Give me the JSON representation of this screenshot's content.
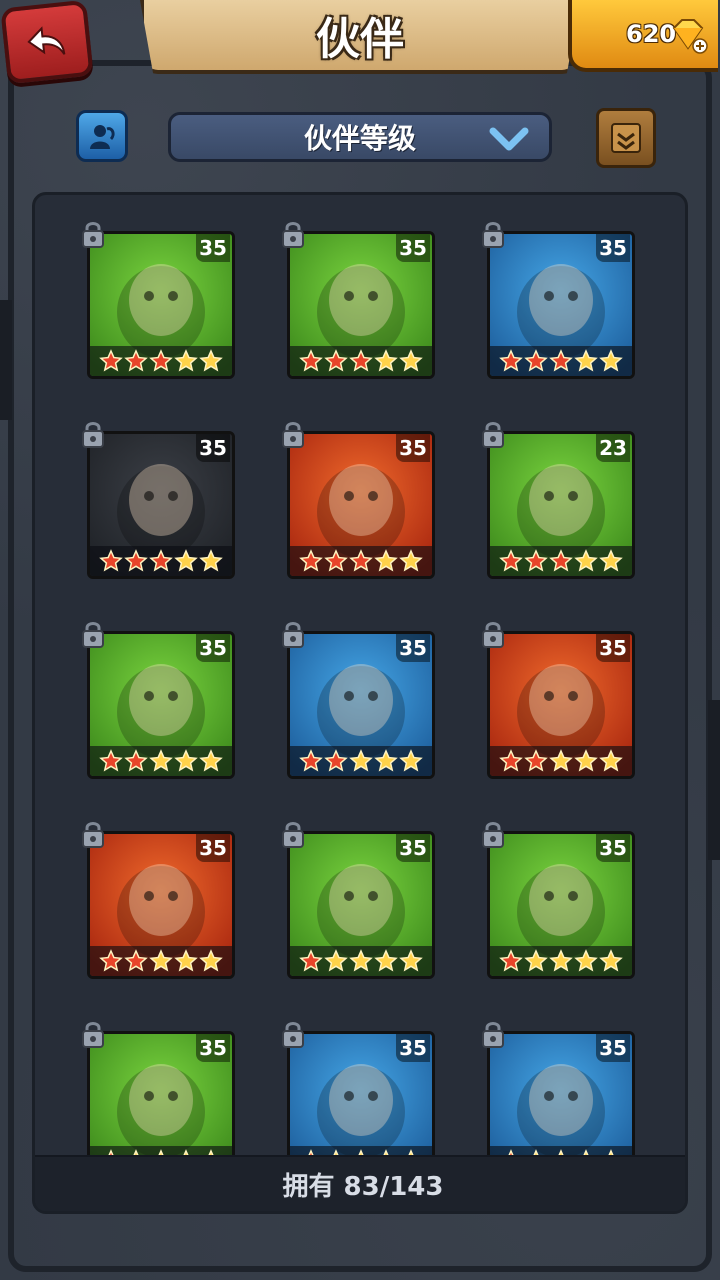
{
  "header": {
    "title": "伙伴",
    "gems": "620"
  },
  "toolbar": {
    "sort_label": "伙伴等级"
  },
  "colors": {
    "star_gold": "#ffd24a",
    "star_red": "#e8452a",
    "bg_green": "#4fb02c",
    "bg_blue": "#2f86c8",
    "bg_red": "#d9421c"
  },
  "companions": [
    {
      "level": "35",
      "stars": 5,
      "red_stars": 3,
      "bg": "green",
      "icon": "green-dino-icon"
    },
    {
      "level": "35",
      "stars": 5,
      "red_stars": 3,
      "bg": "green",
      "icon": "bandana-warrior-icon"
    },
    {
      "level": "35",
      "stars": 5,
      "red_stars": 3,
      "bg": "blue",
      "icon": "pirate-brute-icon"
    },
    {
      "level": "35",
      "stars": 5,
      "red_stars": 3,
      "bg": "dark",
      "icon": "horned-beast-icon"
    },
    {
      "level": "35",
      "stars": 5,
      "red_stars": 3,
      "bg": "red",
      "icon": "skull-huntress-icon"
    },
    {
      "level": "23",
      "stars": 5,
      "red_stars": 3,
      "bg": "green",
      "icon": "scarecrow-icon"
    },
    {
      "level": "35",
      "stars": 5,
      "red_stars": 2,
      "bg": "green",
      "icon": "ninja-girl-icon"
    },
    {
      "level": "35",
      "stars": 5,
      "red_stars": 2,
      "bg": "blue",
      "icon": "boar-warrior-icon"
    },
    {
      "level": "35",
      "stars": 5,
      "red_stars": 2,
      "bg": "red",
      "icon": "hooded-spirit-icon"
    },
    {
      "level": "35",
      "stars": 5,
      "red_stars": 2,
      "bg": "red",
      "icon": "lion-dancer-icon"
    },
    {
      "level": "35",
      "stars": 5,
      "red_stars": 1,
      "bg": "green",
      "icon": "mammoth-icon"
    },
    {
      "level": "35",
      "stars": 5,
      "red_stars": 1,
      "bg": "green",
      "icon": "white-hair-archer-icon"
    },
    {
      "level": "35",
      "stars": 5,
      "red_stars": 1,
      "bg": "green",
      "icon": "armored-turtle-icon"
    },
    {
      "level": "35",
      "stars": 5,
      "red_stars": 1,
      "bg": "blue",
      "icon": "dark-haired-woman-icon"
    },
    {
      "level": "35",
      "stars": 5,
      "red_stars": 1,
      "bg": "blue",
      "icon": "masked-mage-icon"
    }
  ],
  "footer": {
    "owned_text": "拥有 83/143"
  }
}
